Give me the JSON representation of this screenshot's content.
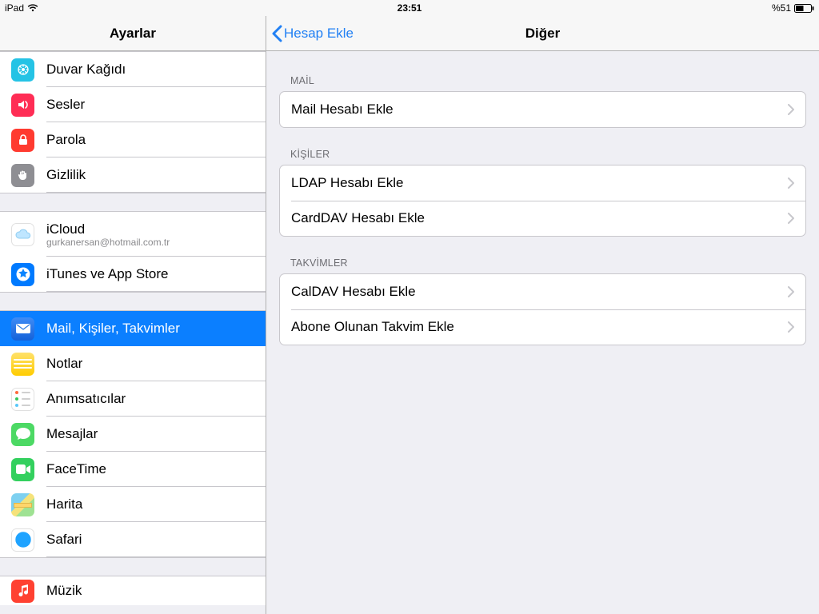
{
  "status": {
    "device": "iPad",
    "time": "23:51",
    "battery": "%51"
  },
  "sidebar_title": "Ayarlar",
  "sidebar": {
    "group1": [
      {
        "key": "wallpaper",
        "label": "Duvar Kağıdı"
      },
      {
        "key": "sounds",
        "label": "Sesler"
      },
      {
        "key": "passcode",
        "label": "Parola"
      },
      {
        "key": "privacy",
        "label": "Gizlilik"
      }
    ],
    "group2": [
      {
        "key": "icloud",
        "label": "iCloud",
        "sub": "gurkanersan@hotmail.com.tr"
      },
      {
        "key": "itunes",
        "label": "iTunes ve App Store"
      }
    ],
    "group3": [
      {
        "key": "mail",
        "label": "Mail, Kişiler, Takvimler",
        "selected": true
      },
      {
        "key": "notes",
        "label": "Notlar"
      },
      {
        "key": "reminders",
        "label": "Anımsatıcılar"
      },
      {
        "key": "messages",
        "label": "Mesajlar"
      },
      {
        "key": "facetime",
        "label": "FaceTime"
      },
      {
        "key": "maps",
        "label": "Harita"
      },
      {
        "key": "safari",
        "label": "Safari"
      }
    ],
    "group4": [
      {
        "key": "music",
        "label": "Müzik"
      }
    ]
  },
  "detail": {
    "back_label": "Hesap Ekle",
    "title": "Diğer",
    "sections": {
      "mail": {
        "header": "MAİL",
        "items": [
          "Mail Hesabı Ekle"
        ]
      },
      "contacts": {
        "header": "KİŞİLER",
        "items": [
          "LDAP Hesabı Ekle",
          "CardDAV Hesabı Ekle"
        ]
      },
      "cal": {
        "header": "TAKVİMLER",
        "items": [
          "CalDAV Hesabı Ekle",
          "Abone Olunan Takvim Ekle"
        ]
      }
    }
  }
}
